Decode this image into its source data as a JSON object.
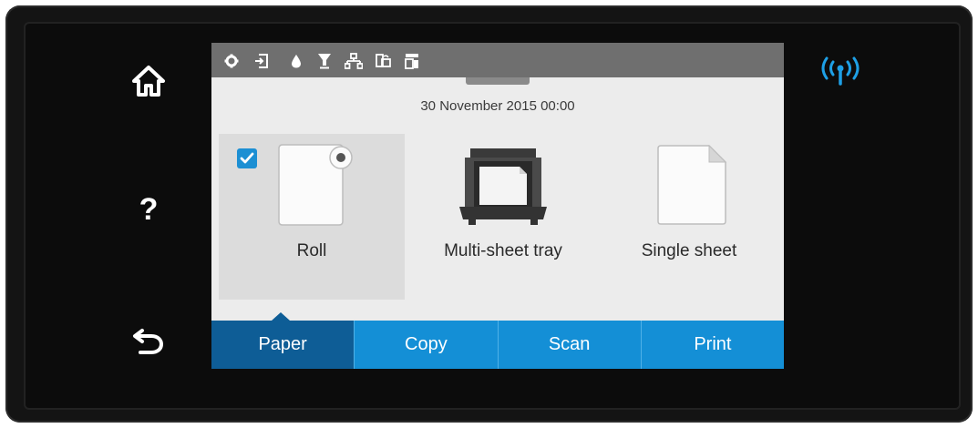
{
  "side_buttons": {
    "home_icon": "home-icon",
    "help_label": "?",
    "back_icon": "back-arrow-icon"
  },
  "status_bar": {
    "icons": [
      "gear-icon",
      "paper-load-icon",
      "ink-drop-icon",
      "printhead-icon",
      "network-icon",
      "mobile-print-icon",
      "wireless-direct-icon"
    ]
  },
  "datetime": "30 November 2015 00:00",
  "paper_sources": [
    {
      "label": "Roll",
      "selected": true,
      "icon": "roll-paper-icon"
    },
    {
      "label": "Multi-sheet tray",
      "selected": false,
      "icon": "tray-icon"
    },
    {
      "label": "Single sheet",
      "selected": false,
      "icon": "single-sheet-icon"
    }
  ],
  "tabs": [
    {
      "label": "Paper",
      "active": true
    },
    {
      "label": "Copy",
      "active": false
    },
    {
      "label": "Scan",
      "active": false
    },
    {
      "label": "Print",
      "active": false
    }
  ],
  "wireless_indicator": "wireless-signal-icon",
  "colors": {
    "accent": "#148fd6",
    "active_tab": "#0e5d96",
    "wireless": "#1ea0e6"
  }
}
